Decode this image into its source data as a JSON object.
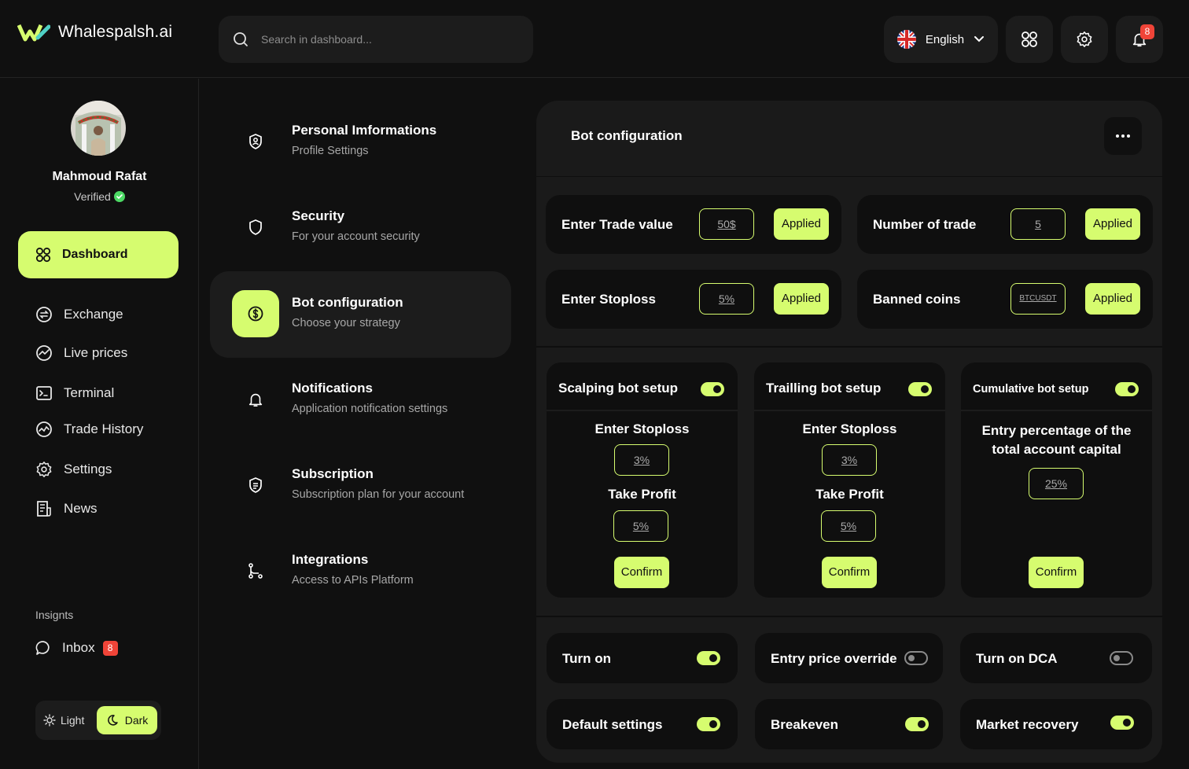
{
  "app": {
    "name": "Whalespalsh.ai"
  },
  "search": {
    "placeholder": "Search in dashboard..."
  },
  "header": {
    "language": "English",
    "notifications_count": "8"
  },
  "user": {
    "name": "Mahmoud Rafat",
    "status": "Verified"
  },
  "sidebar": {
    "dashboard": "Dashboard",
    "items": [
      {
        "label": "Exchange",
        "icon": "exchange-icon"
      },
      {
        "label": "Live prices",
        "icon": "chart-icon"
      },
      {
        "label": "Terminal",
        "icon": "terminal-icon"
      },
      {
        "label": "Trade History",
        "icon": "history-icon"
      },
      {
        "label": "Settings",
        "icon": "gear-icon"
      },
      {
        "label": "News",
        "icon": "news-icon"
      }
    ],
    "insights": "Insignts",
    "inbox": "Inbox",
    "inbox_count": "8",
    "theme_light": "Light",
    "theme_dark": "Dark"
  },
  "menu": [
    {
      "title": "Personal Imformations",
      "subtitle": "Profile Settings",
      "icon": "user-shield-icon"
    },
    {
      "title": "Security",
      "subtitle": "For your account security",
      "icon": "shield-icon"
    },
    {
      "title": "Bot configuration",
      "subtitle": "Choose your strategy",
      "icon": "dollar-circle-icon"
    },
    {
      "title": "Notifications",
      "subtitle": "Application notification settings",
      "icon": "bell-icon"
    },
    {
      "title": "Subscription",
      "subtitle": "Subscription plan for your account",
      "icon": "subscription-icon"
    },
    {
      "title": "Integrations",
      "subtitle": "Access to APIs Platform",
      "icon": "branch-icon"
    }
  ],
  "panel": {
    "title": "Bot configuration",
    "inputs": [
      {
        "label": "Enter Trade value",
        "value": "50$",
        "button": "Applied"
      },
      {
        "label": "Number of trade",
        "value": "5",
        "button": "Applied"
      },
      {
        "label": "Enter Stoploss",
        "value": "5%",
        "button": "Applied"
      },
      {
        "label": "Banned coins",
        "value": "BTCUSDT",
        "button": "Applied"
      }
    ],
    "bots": [
      {
        "title": "Scalping bot setup",
        "enabled": true,
        "stoploss_label": "Enter Stoploss",
        "stoploss": "3%",
        "takeprofit_label": "Take Profit",
        "takeprofit": "5%",
        "confirm": "Confirm"
      },
      {
        "title": "Trailling bot setup",
        "enabled": true,
        "stoploss_label": "Enter Stoploss",
        "stoploss": "3%",
        "takeprofit_label": "Take Profit",
        "takeprofit": "5%",
        "confirm": "Confirm"
      },
      {
        "title": "Cumulative bot setup",
        "enabled": true,
        "entry_label": "Entry percentage of the total account capital",
        "entry": "25%",
        "confirm": "Confirm"
      }
    ],
    "options": [
      {
        "label": "Turn on",
        "enabled": true
      },
      {
        "label": "Entry price override",
        "enabled": false
      },
      {
        "label": "Turn on DCA",
        "enabled": false
      },
      {
        "label": "Default settings",
        "enabled": true
      },
      {
        "label": "Breakeven",
        "enabled": true
      },
      {
        "label": "Market recovery",
        "enabled": true
      }
    ]
  },
  "colors": {
    "accent": "#d6fc6f",
    "background": "#101010",
    "surface": "#1c1c1c",
    "badge": "#f04438"
  }
}
